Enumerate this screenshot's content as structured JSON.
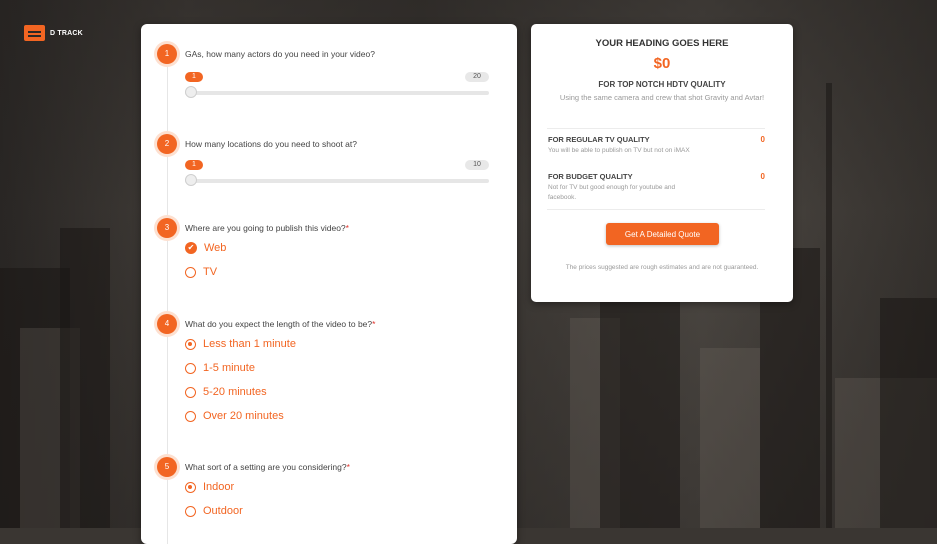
{
  "brand": {
    "name": "D TRACK",
    "accent": "#f26522"
  },
  "questions": [
    {
      "number": "1",
      "title": "GAs, how many actors do you need in your video?",
      "required": false,
      "slider": {
        "min_label": "1",
        "max_label": "20",
        "value": 1
      }
    },
    {
      "number": "2",
      "title": "How many locations do you need to shoot at?",
      "required": false,
      "slider": {
        "min_label": "1",
        "max_label": "10",
        "value": 1
      }
    },
    {
      "number": "3",
      "title": "Where are you going to publish this video?",
      "required": true,
      "type": "checkbox",
      "options": [
        {
          "label": "Web",
          "selected": true
        },
        {
          "label": "TV",
          "selected": false
        }
      ]
    },
    {
      "number": "4",
      "title": "What do you expect the length of the video to be?",
      "required": true,
      "type": "radio",
      "options": [
        {
          "label": "Less than 1 minute",
          "selected": true
        },
        {
          "label": "1-5 minute",
          "selected": false
        },
        {
          "label": "5-20 minutes",
          "selected": false
        },
        {
          "label": "Over 20 minutes",
          "selected": false
        }
      ]
    },
    {
      "number": "5",
      "title": "What sort of a setting are you considering?",
      "required": true,
      "type": "radio",
      "options": [
        {
          "label": "Indoor",
          "selected": true
        },
        {
          "label": "Outdoor",
          "selected": false
        }
      ]
    }
  ],
  "required_mark": "*",
  "quote": {
    "heading": "YOUR HEADING GOES HERE",
    "price": "$0",
    "subheading": "FOR TOP NOTCH HDTV QUALITY",
    "description": "Using the same camera and crew that shot Gravity and Avtar!",
    "tiers": [
      {
        "name": "FOR REGULAR TV QUALITY",
        "desc": "You will be able to publish on TV but not on iMAX",
        "value": "0"
      },
      {
        "name": "FOR BUDGET QUALITY",
        "desc": "Not for TV but good enough for youtube and facebook.",
        "value": "0"
      }
    ],
    "button_label": "Get A Detailed Quote",
    "note": "The prices suggested are rough estimates and are not guaranteed."
  }
}
